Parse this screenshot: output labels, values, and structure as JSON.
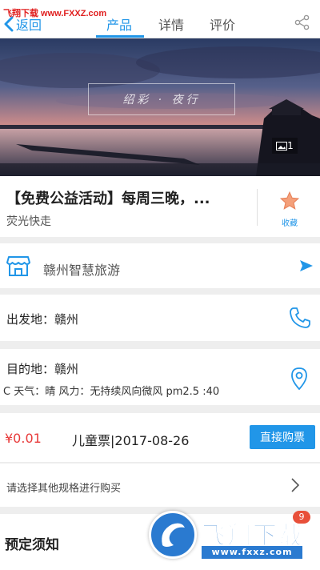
{
  "watermark": {
    "text": "飞翔下载 www.FXXZ.com"
  },
  "nav": {
    "back_label": "返回",
    "tabs": [
      {
        "label": "产品",
        "active": true
      },
      {
        "label": "详情",
        "active": false
      },
      {
        "label": "评价",
        "active": false
      }
    ],
    "share_icon": "share-icon"
  },
  "hero": {
    "caption": "绍彩 · 夜行",
    "photo_count": "1"
  },
  "product": {
    "title": "【免费公益活动】每周三晚，...",
    "subtitle": "荧光快走",
    "favorite_label": "收藏"
  },
  "shop": {
    "name": "赣州智慧旅游"
  },
  "departure": {
    "label": "出发地：",
    "value": "赣州"
  },
  "destination": {
    "label": "目的地：",
    "value": "赣州",
    "weather": "C 天气：晴 风力：无持续风向微风 pm2.5 :40"
  },
  "ticket": {
    "price": "¥0.01",
    "name": "儿童票|2017-08-26",
    "buy_label": "直接购票"
  },
  "spec": {
    "text": "请选择其他规格进行购买"
  },
  "notice": {
    "title": "预定须知"
  },
  "logo_watermark": {
    "brand": "飞翔下载",
    "url": "www.fxxz.com",
    "badge": "9"
  },
  "colors": {
    "accent": "#2196e8",
    "price": "#e83a3a",
    "background": "#eeeeee"
  }
}
